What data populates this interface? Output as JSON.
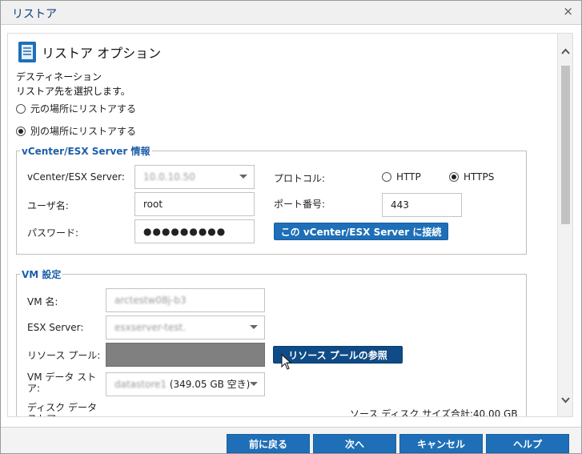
{
  "window": {
    "title": "リストア",
    "close_glyph": "×"
  },
  "header": {
    "title": "リストア オプション",
    "icon": "document-stack-icon"
  },
  "destination": {
    "heading": "デスティネーション",
    "subtext": "リストア先を選択します。",
    "options": [
      {
        "label": "元の場所にリストアする",
        "selected": false
      },
      {
        "label": "別の場所にリストアする",
        "selected": true
      }
    ]
  },
  "vcenter": {
    "legend": "vCenter/ESX Server 情報",
    "server_label": "vCenter/ESX Server:",
    "server_value": "10.0.10.50",
    "protocol_label": "プロトコル:",
    "protocol_options": [
      {
        "label": "HTTP",
        "selected": false
      },
      {
        "label": "HTTPS",
        "selected": true
      }
    ],
    "user_label": "ユーザ名:",
    "user_value": "root",
    "port_label": "ポート番号:",
    "port_value": "443",
    "password_label": "パスワード:",
    "password_value": "●●●●●●●●●",
    "connect_button": "この vCenter/ESX Server に接続"
  },
  "vm": {
    "legend": "VM 設定",
    "name_label": "VM 名:",
    "name_value": "arctestw08j-b3",
    "esx_label": "ESX Server:",
    "esx_value": "esxserver-test.",
    "pool_label": "リソース プール:",
    "pool_button": "リソース プールの参照",
    "datastore_label": "VM データ スト\nア:",
    "datastore_value_hidden": "datastore1",
    "datastore_value_suffix": " (349.05 GB 空き)",
    "disk_ds_label": "ディスク データ\nストア:",
    "source_total": "ソース ディスク サイズ合計:40.00 GB"
  },
  "footer": {
    "back": "前に戻る",
    "next": "次へ",
    "cancel": "キャンセル",
    "help": "ヘルプ"
  },
  "colors": {
    "accent": "#1e6fb8",
    "accent_dark": "#0f4b86",
    "legend": "#1f5fa8"
  }
}
